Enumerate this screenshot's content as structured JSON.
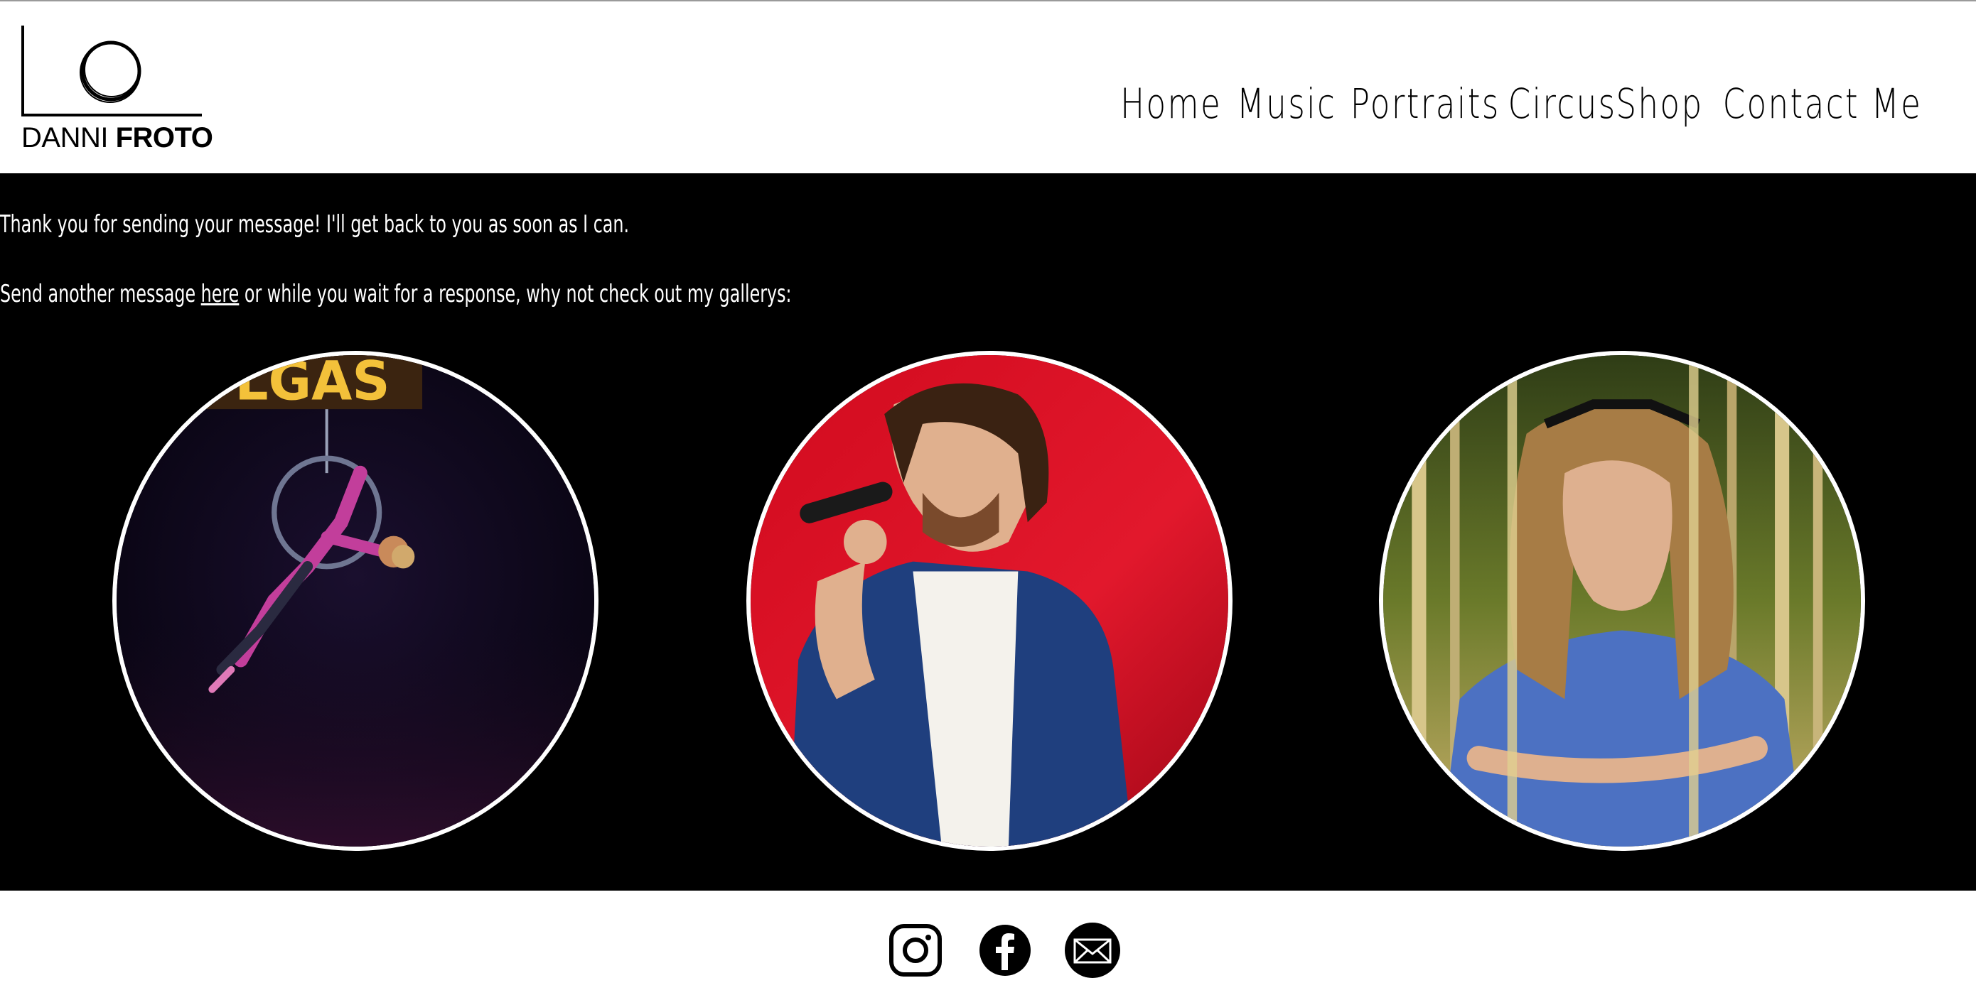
{
  "header": {
    "logo": {
      "brand_first": "DANNI",
      "brand_second": "FROTO"
    },
    "nav": {
      "home": "Home",
      "music": "Music",
      "portraits": "Portraits",
      "circus": "Circus",
      "shop": "Shop",
      "contact": "Contact Me"
    }
  },
  "main": {
    "thank_you": "Thank you for sending your message! I'll get back to you as soon as I can.",
    "send_another_prefix": "Send another message ",
    "send_another_link": "here",
    "send_another_suffix": " or while you wait for a response, why not check out my gallerys:",
    "galleries": [
      {
        "name": "circus-gallery",
        "sign_text": "LGAS"
      },
      {
        "name": "music-gallery"
      },
      {
        "name": "portraits-gallery"
      }
    ]
  },
  "footer": {
    "icons": [
      "instagram-icon",
      "facebook-icon",
      "email-icon"
    ]
  },
  "colors": {
    "background": "#000000",
    "header_bg": "#ffffff",
    "text_light": "#ffffff",
    "text_dark": "#000000"
  }
}
